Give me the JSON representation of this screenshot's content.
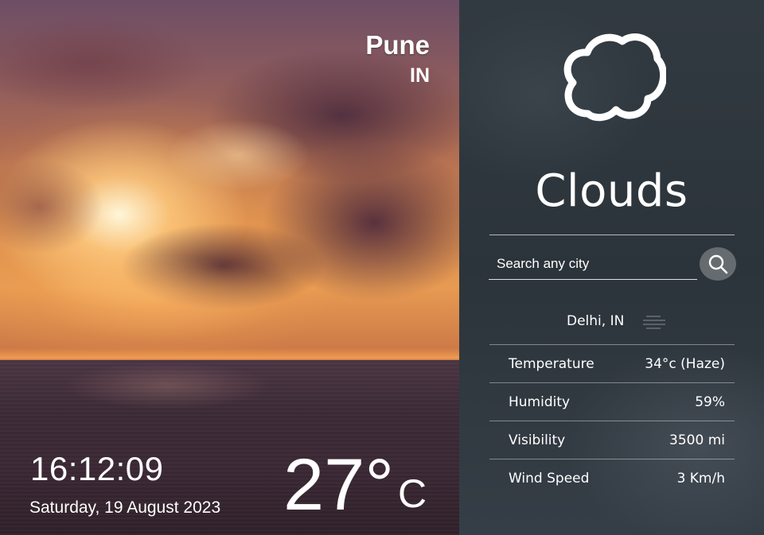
{
  "hero": {
    "city": "Pune",
    "country": "IN",
    "time": "16:12:09",
    "date": "Saturday, 19 August 2023",
    "temperature": "27°",
    "temperature_unit": "C"
  },
  "panel": {
    "weather_icon": "cloud-icon",
    "condition": "Clouds",
    "search": {
      "placeholder": "Search any city",
      "button_icon": "search-icon"
    },
    "result": {
      "location": "Delhi, IN",
      "icon": "haze-icon"
    },
    "stats": [
      {
        "label": "Temperature",
        "value": "34°c (Haze)"
      },
      {
        "label": "Humidity",
        "value": "59%"
      },
      {
        "label": "Visibility",
        "value": "3500 mi"
      },
      {
        "label": "Wind Speed",
        "value": "3 Km/h"
      }
    ]
  }
}
